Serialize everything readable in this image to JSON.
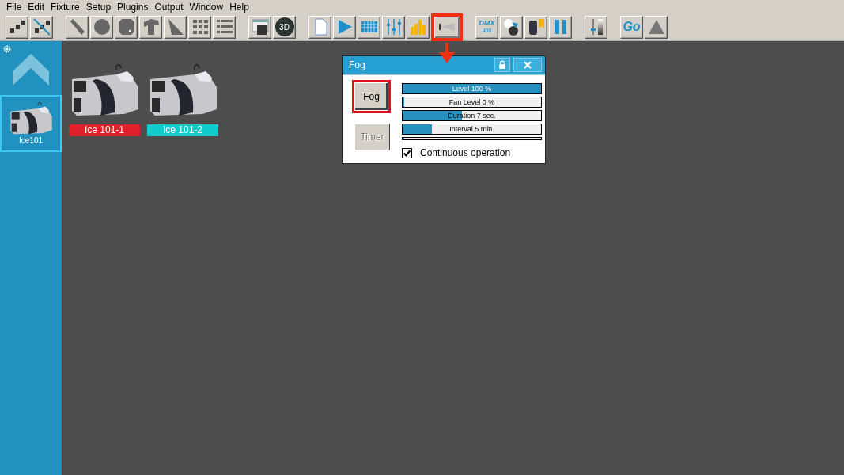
{
  "menu": [
    "File",
    "Edit",
    "Fixture",
    "Setup",
    "Plugins",
    "Output",
    "Window",
    "Help"
  ],
  "toolbar": [
    [
      {
        "kind": "fixtures",
        "highlighted": false
      },
      {
        "kind": "fixtures-crossed",
        "highlighted": false
      }
    ],
    [
      {
        "kind": "wand",
        "highlighted": false
      },
      {
        "kind": "circle",
        "highlighted": false
      },
      {
        "kind": "circle-dot",
        "highlighted": false
      },
      {
        "kind": "shape",
        "highlighted": false
      },
      {
        "kind": "triangle",
        "highlighted": false
      },
      {
        "kind": "grid",
        "highlighted": false
      },
      {
        "kind": "list",
        "highlighted": false
      }
    ],
    [
      {
        "kind": "window",
        "highlighted": false
      },
      {
        "kind": "badge",
        "label": "3D",
        "highlighted": false
      }
    ],
    [
      {
        "kind": "page",
        "highlighted": false
      },
      {
        "kind": "play",
        "highlighted": false
      },
      {
        "kind": "matrix",
        "highlighted": false
      },
      {
        "kind": "sliders",
        "highlighted": false
      },
      {
        "kind": "bars",
        "highlighted": false
      },
      {
        "kind": "fog",
        "highlighted": true
      }
    ],
    [
      {
        "kind": "dmx",
        "label": "DMX",
        "sublabel": "400",
        "highlighted": false
      },
      {
        "kind": "color-swap",
        "highlighted": false
      },
      {
        "kind": "moving-head",
        "highlighted": false
      },
      {
        "kind": "pause",
        "highlighted": false
      }
    ],
    [
      {
        "kind": "fader",
        "highlighted": false
      }
    ],
    [
      {
        "kind": "text",
        "label": "Go",
        "highlighted": false
      },
      {
        "kind": "warning",
        "highlighted": false
      }
    ]
  ],
  "sidebar": {
    "items": [
      {
        "label": "Ice101",
        "selected": true
      }
    ]
  },
  "fixtures": [
    {
      "label": "Ice 101-1",
      "color": "#e0202a"
    },
    {
      "label": "Ice 101-2",
      "color": "#10cccc"
    }
  ],
  "dialog": {
    "title": "Fog",
    "buttons": [
      {
        "label": "Fog",
        "disabled": false,
        "highlighted": true
      },
      {
        "label": "Timer",
        "disabled": true,
        "highlighted": false
      }
    ],
    "bars": [
      {
        "label": "Level 100 %",
        "level": 1.0
      },
      {
        "label": "Fan Level 0 %",
        "level": 0.0
      },
      {
        "label": "Duration 7 sec.",
        "level": 0.43
      },
      {
        "label": "Interval 5 min.",
        "level": 0.21
      },
      {
        "level": 0.0
      }
    ],
    "checkbox": {
      "label": "Continuous operation",
      "checked": true
    }
  }
}
